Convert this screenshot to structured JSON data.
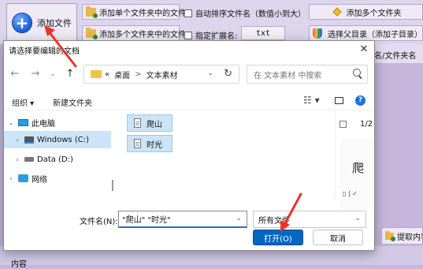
{
  "app": {
    "add_file_label": "添加文件",
    "add_single_folder": "添加单个文件夹中的文件",
    "add_multi_folder": "添加多个文件夹中的文件",
    "auto_sort_label": "自动排序文件名（数值小到大）",
    "ext_label": "指定扩展名:",
    "ext_value": "txt",
    "add_multiple_folders": "添加多个文件夹",
    "select_parent_dir": "选择父目录（添加子目录）",
    "column_fragment": "名/文件夹名",
    "extract_fragment": "提取内容",
    "bottom_fragment": "内容"
  },
  "dialog": {
    "title": "请选择要编辑的文档",
    "address": {
      "overflow": "«",
      "crumbs": [
        "桌面",
        "文本素材"
      ],
      "separator": ">"
    },
    "search_placeholder": "在 文本素材 中搜索",
    "toolbar": {
      "organize": "组织 ▾",
      "new_folder": "新建文件夹"
    },
    "tree": {
      "this_pc": "此电脑",
      "windows_c": "Windows (C:)",
      "data_d": "Data (D:)",
      "network": "网络"
    },
    "files": [
      "爬山",
      "时光"
    ],
    "preview": {
      "page": "1/2",
      "char": "爬",
      "snippet": "▯ | ✓"
    },
    "filename_label": "文件名(N):",
    "filename_value": "\"爬山\" \"时光\"",
    "filetype_value": "所有文件",
    "open_button": "打开(O)",
    "cancel_button": "取消"
  },
  "colors": {
    "accent": "#0067c0",
    "annotation_arrow": "#e8342c",
    "selection": "#cce4f7"
  }
}
